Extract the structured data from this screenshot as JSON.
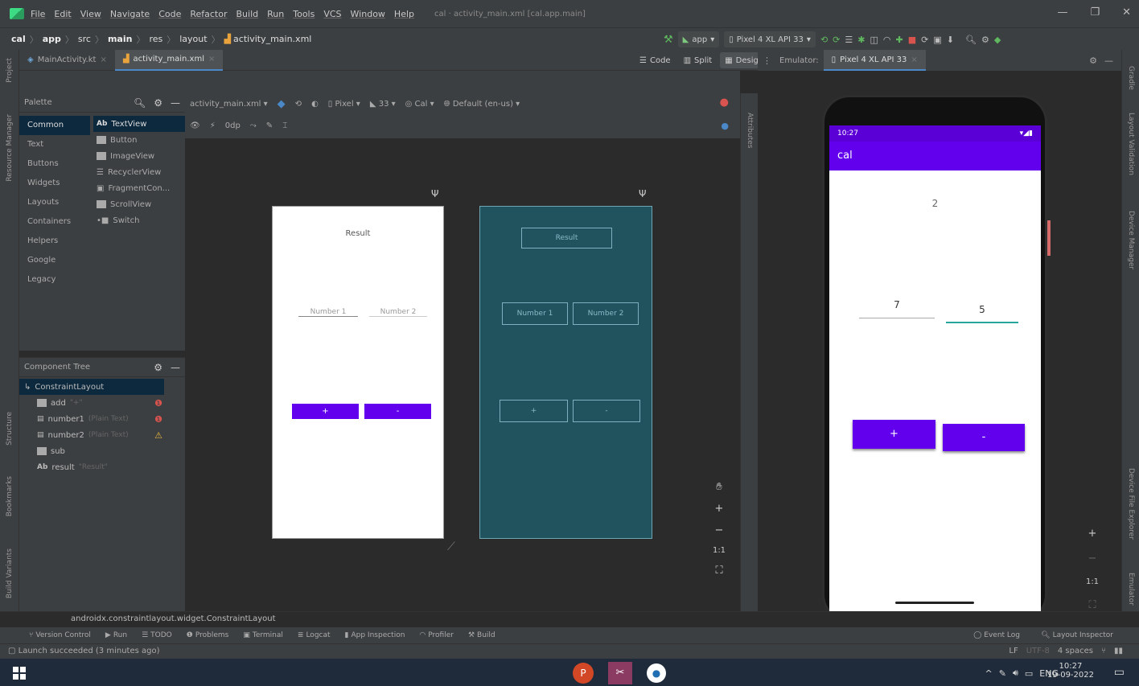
{
  "menubar": {
    "items": [
      "File",
      "Edit",
      "View",
      "Navigate",
      "Code",
      "Refactor",
      "Build",
      "Run",
      "Tools",
      "VCS",
      "Window",
      "Help"
    ],
    "window_title": "cal · activity_main.xml [cal.app.main]"
  },
  "breadcrumb": {
    "project": "cal",
    "module": "app",
    "src": "src",
    "main": "main",
    "res": "res",
    "layout": "layout",
    "file": "activity_main.xml"
  },
  "toolbar": {
    "run_config": "app",
    "device": "Pixel 4 XL API 33"
  },
  "editor_tabs": [
    "MainActivity.kt",
    "activity_main.xml"
  ],
  "emulator_tab": {
    "label": "Emulator:",
    "device": "Pixel 4 XL API 33"
  },
  "view_modes": {
    "code": "Code",
    "split": "Split",
    "design": "Design"
  },
  "palette": {
    "title": "Palette",
    "categories": [
      "Common",
      "Text",
      "Buttons",
      "Widgets",
      "Layouts",
      "Containers",
      "Helpers",
      "Google",
      "Legacy"
    ],
    "widgets": [
      "TextView",
      "Button",
      "ImageView",
      "RecyclerView",
      "FragmentCon...",
      "ScrollView",
      "Switch"
    ]
  },
  "design_toolbar": {
    "file": "activity_main.xml",
    "device": "Pixel",
    "api": "33",
    "theme": "Cal",
    "locale": "Default (en-us)",
    "margin": "0dp"
  },
  "component_tree": {
    "title": "Component Tree",
    "root": "ConstraintLayout",
    "nodes": [
      {
        "name": "add",
        "hint": "\"+\""
      },
      {
        "name": "number1",
        "hint": "(Plain Text)"
      },
      {
        "name": "number2",
        "hint": "(Plain Text)"
      },
      {
        "name": "sub",
        "hint": ""
      },
      {
        "name": "result",
        "hint": "\"Result\""
      }
    ]
  },
  "blueprint": {
    "result_label": "Result",
    "number1_hint": "Number 1",
    "number2_hint": "Number 2",
    "add_label": "+",
    "sub_label": "-"
  },
  "phone": {
    "time": "10:27",
    "app_title": "cal",
    "result_value": "2",
    "number1_value": "7",
    "number2_value": "5",
    "add_label": "+",
    "sub_label": "-"
  },
  "attributes_label": "Attributes",
  "class_path": "androidx.constraintlayout.widget.ConstraintLayout",
  "tool_windows": [
    "Version Control",
    "Run",
    "TODO",
    "Problems",
    "Terminal",
    "Logcat",
    "App Inspection",
    "Profiler",
    "Build"
  ],
  "tool_windows_right": [
    "Event Log",
    "Layout Inspector"
  ],
  "status": {
    "message": "Launch succeeded (3 minutes ago)",
    "line_sep": "LF",
    "encoding": "UTF-8",
    "indent": "4 spaces"
  },
  "left_strip": [
    "Project",
    "Resource Manager",
    "Structure",
    "Bookmarks",
    "Build Variants"
  ],
  "right_strip": [
    "Gradle",
    "Layout Validation",
    "Device Manager",
    "Device File Explorer",
    "Emulator"
  ],
  "taskbar": {
    "time": "10:27",
    "date": "19-09-2022",
    "lang": "ENG"
  },
  "colors": {
    "accent": "#6200ee",
    "blueprint": "#21535f",
    "ide_bg": "#2b2b2b",
    "panel": "#3c3f41"
  }
}
